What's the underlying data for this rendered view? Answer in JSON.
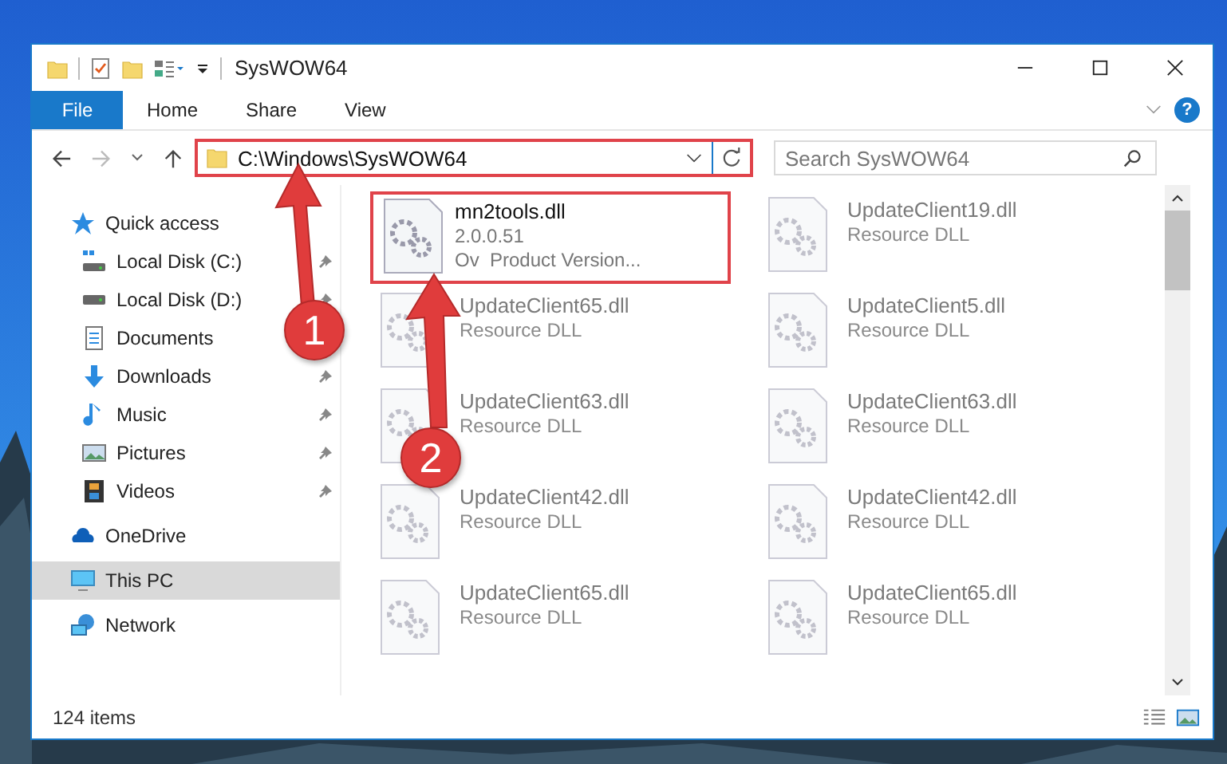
{
  "window": {
    "title": "SysWOW64"
  },
  "ribbon": {
    "file_button": "File",
    "tabs": [
      {
        "label": "Home",
        "selected": false
      },
      {
        "label": "Share",
        "selected": false
      },
      {
        "label": "View",
        "selected": false
      }
    ],
    "help": "?"
  },
  "address": {
    "path": "C:\\Windows\\SysWOW64",
    "highlighted": true
  },
  "search": {
    "placeholder": "Search SysWOW64"
  },
  "sidebar": {
    "items": [
      {
        "label": "Quick access",
        "kind": "quick",
        "selected": false,
        "children": [
          {
            "label": "Local Disk (C:)",
            "kind": "disk_c",
            "pinned": true,
            "selected": false
          },
          {
            "label": "Local Disk (D:)",
            "kind": "disk",
            "pinned": true,
            "selected": false
          },
          {
            "label": "Documents",
            "kind": "documents",
            "selected": false
          },
          {
            "label": "Downloads",
            "kind": "downloads",
            "pinned": true,
            "selected": false
          },
          {
            "label": "Music",
            "kind": "music",
            "pinned": true,
            "selected": false
          },
          {
            "label": "Pictures",
            "kind": "pictures",
            "pinned": true,
            "selected": false
          },
          {
            "label": "Videos",
            "kind": "videos",
            "pinned": true,
            "selected": false
          }
        ]
      },
      {
        "label": "OneDrive",
        "kind": "onedrive",
        "selected": false
      },
      {
        "label": "This PC",
        "kind": "pc",
        "selected": true
      },
      {
        "label": "Network",
        "kind": "network",
        "selected": false
      }
    ]
  },
  "files": [
    {
      "name": "mn2tools.dll",
      "details": [
        "2.0.0.51",
        "Ov  Product Version..."
      ],
      "highlighted": true,
      "blurred": false
    },
    {
      "name": "UpdateClient19.dll",
      "details": [
        "Resource DLL"
      ],
      "highlighted": false,
      "blurred": true
    },
    {
      "name": "UpdateClient65.dll",
      "details": [
        "Resource DLL"
      ],
      "highlighted": false,
      "blurred": true
    },
    {
      "name": "UpdateClient5.dll",
      "details": [
        "Resource DLL"
      ],
      "highlighted": false,
      "blurred": true
    },
    {
      "name": "UpdateClient63.dll",
      "details": [
        "Resource DLL"
      ],
      "highlighted": false,
      "blurred": true
    },
    {
      "name": "UpdateClient63.dll",
      "details": [
        "Resource DLL"
      ],
      "highlighted": false,
      "blurred": true
    },
    {
      "name": "UpdateClient42.dll",
      "details": [
        "Resource DLL"
      ],
      "highlighted": false,
      "blurred": true
    },
    {
      "name": "UpdateClient42.dll",
      "details": [
        "Resource DLL"
      ],
      "highlighted": false,
      "blurred": true
    },
    {
      "name": "UpdateClient65.dll",
      "details": [
        "Resource DLL"
      ],
      "highlighted": false,
      "blurred": true
    },
    {
      "name": "UpdateClient65.dll",
      "details": [
        "Resource DLL"
      ],
      "highlighted": false,
      "blurred": true
    }
  ],
  "status_bar": {
    "item_count": "124 items"
  },
  "annotations": [
    {
      "label": "1"
    },
    {
      "label": "2"
    }
  ]
}
